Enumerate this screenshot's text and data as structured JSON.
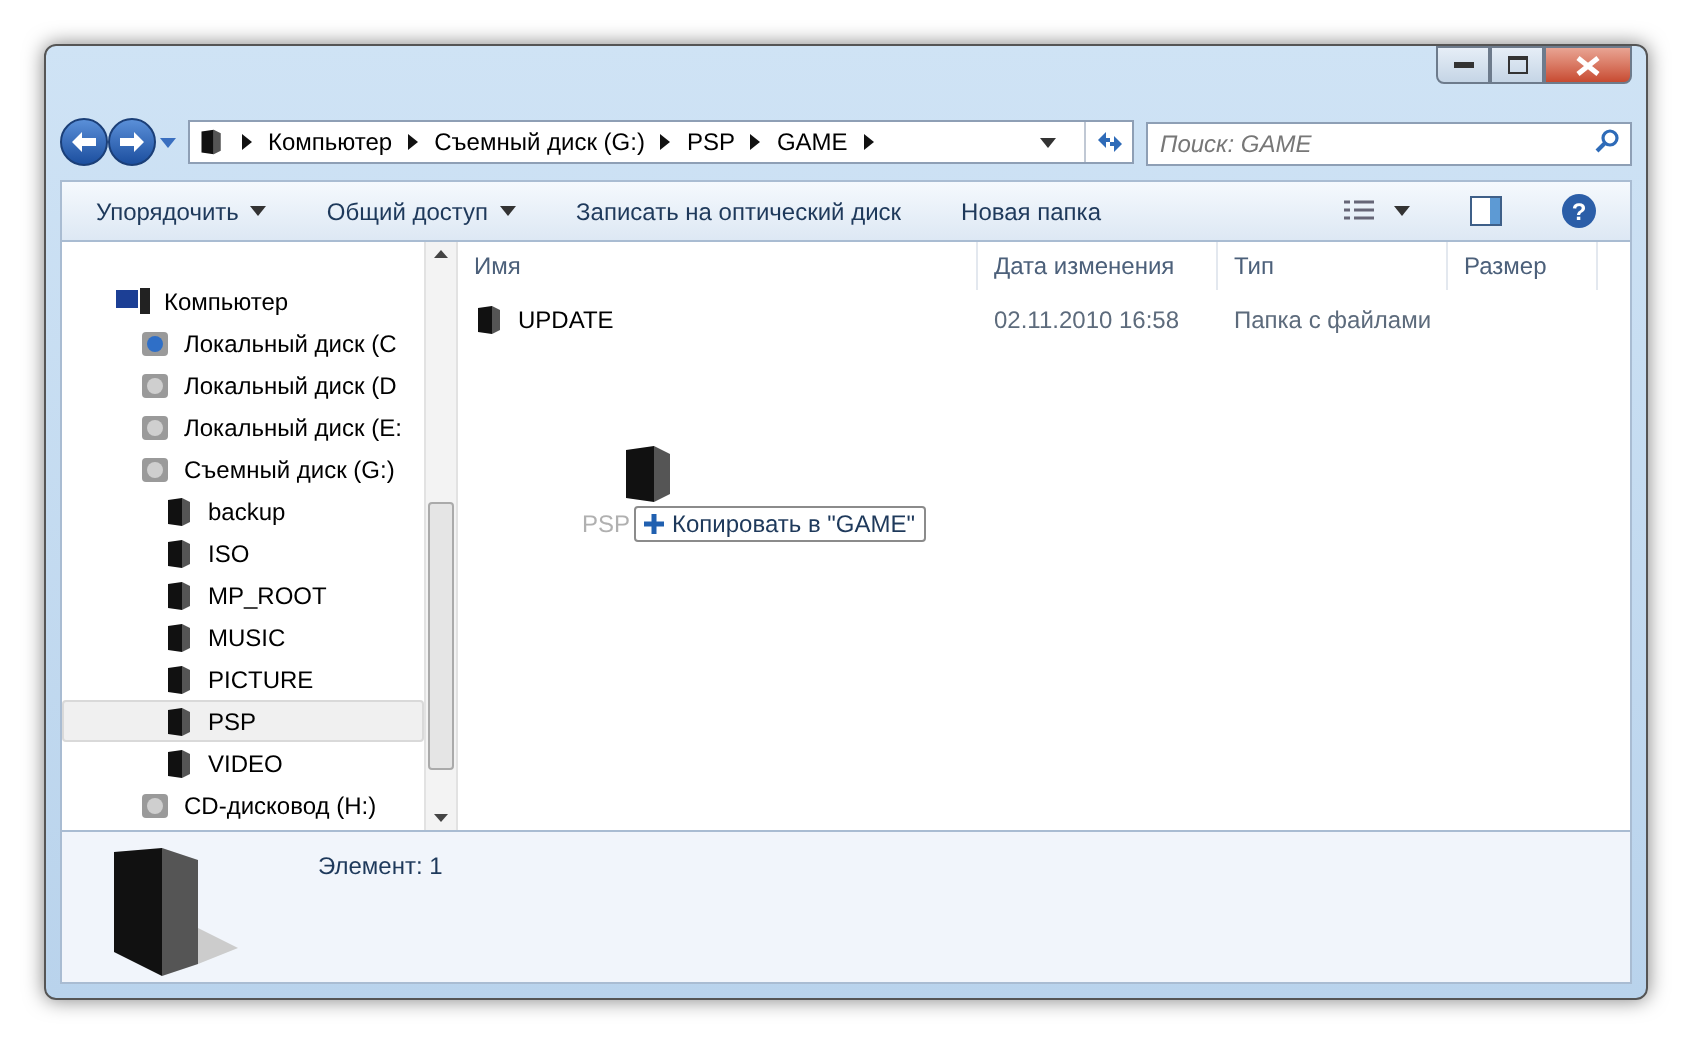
{
  "window": {
    "controls": [
      {
        "kind": "minimize"
      },
      {
        "kind": "maximize"
      },
      {
        "kind": "close"
      }
    ]
  },
  "address_bar": {
    "breadcrumbs": [
      "Компьютер",
      "Съемный диск (G:)",
      "PSP",
      "GAME"
    ]
  },
  "search": {
    "placeholder": "Поиск: GAME"
  },
  "toolbar": {
    "buttons": [
      {
        "label": "Упорядочить",
        "dropdown": true
      },
      {
        "label": "Общий доступ",
        "dropdown": true
      },
      {
        "label": "Записать на оптический диск",
        "dropdown": false
      },
      {
        "label": "Новая папка",
        "dropdown": false
      }
    ],
    "help_glyph": "?"
  },
  "sidebar": {
    "items": [
      {
        "label": "Компьютер",
        "kind": "computer",
        "selected": false,
        "children": [
          {
            "label": "Локальный диск (C",
            "kind": "system-drive",
            "selected": false
          },
          {
            "label": "Локальный диск (D",
            "kind": "drive",
            "selected": false
          },
          {
            "label": "Локальный диск (E:",
            "kind": "drive",
            "selected": false
          },
          {
            "label": "Съемный диск (G:)",
            "kind": "drive",
            "selected": false,
            "children": [
              {
                "label": "backup",
                "kind": "folder",
                "selected": false
              },
              {
                "label": "ISO",
                "kind": "folder",
                "selected": false
              },
              {
                "label": "MP_ROOT",
                "kind": "folder",
                "selected": false
              },
              {
                "label": "MUSIC",
                "kind": "folder",
                "selected": false
              },
              {
                "label": "PICTURE",
                "kind": "folder",
                "selected": false
              },
              {
                "label": "PSP",
                "kind": "folder",
                "selected": true
              },
              {
                "label": "VIDEO",
                "kind": "folder",
                "selected": false
              }
            ]
          },
          {
            "label": "CD-дисковод (H:)",
            "kind": "cd-drive",
            "selected": false
          }
        ]
      }
    ]
  },
  "table": {
    "columns": [
      "Имя",
      "Дата изменения",
      "Тип",
      "Размер"
    ],
    "rows": [
      {
        "name": "UPDATE",
        "date": "02.11.2010 16:58",
        "type": "Папка с файлами"
      }
    ]
  },
  "drag": {
    "item_label": "PSP",
    "tooltip": "Копировать в \"GAME\""
  },
  "details_pane": {
    "text": "Элемент: 1"
  }
}
